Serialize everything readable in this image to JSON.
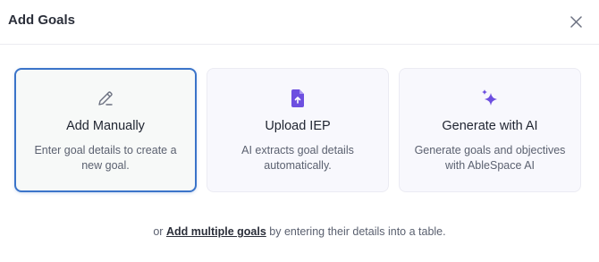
{
  "modal": {
    "title": "Add Goals",
    "close_icon": "close-icon"
  },
  "cards": [
    {
      "title": "Add Manually",
      "description": "Enter goal details to create a new goal.",
      "icon": "pencil-icon",
      "selected": true
    },
    {
      "title": "Upload IEP",
      "description": "AI extracts goal details automatically.",
      "icon": "upload-file-icon"
    },
    {
      "title": "Generate with AI",
      "description": "Generate goals and objectives with AbleSpace AI",
      "icon": "sparkles-icon"
    }
  ],
  "footer": {
    "prefix": "or",
    "link": "Add multiple goals",
    "suffix": "by entering their details into a table."
  },
  "colors": {
    "accent": "#3b74c9",
    "icon_purple": "#6d4fe0"
  }
}
